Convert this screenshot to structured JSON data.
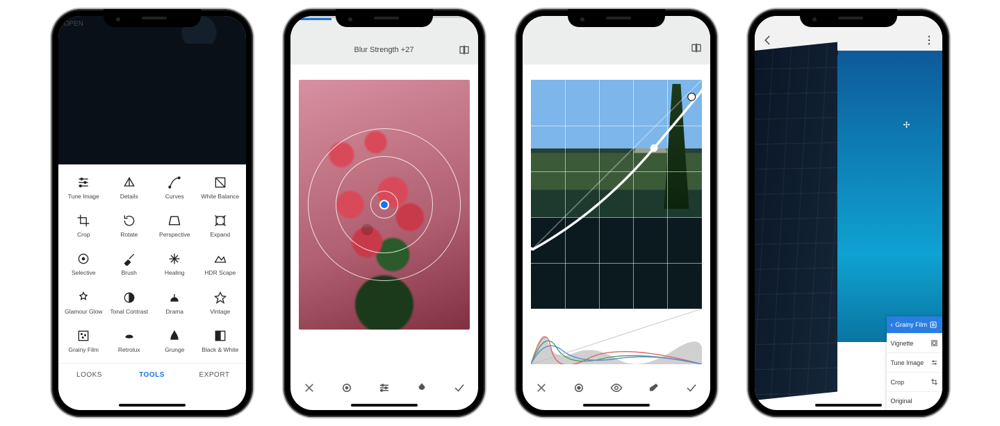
{
  "screen1": {
    "open_label": "OPEN",
    "tools": [
      {
        "label": "Tune Image",
        "icon": "sliders"
      },
      {
        "label": "Details",
        "icon": "details"
      },
      {
        "label": "Curves",
        "icon": "curves"
      },
      {
        "label": "White Balance",
        "icon": "wb"
      },
      {
        "label": "Crop",
        "icon": "crop"
      },
      {
        "label": "Rotate",
        "icon": "rotate"
      },
      {
        "label": "Perspective",
        "icon": "perspective"
      },
      {
        "label": "Expand",
        "icon": "expand"
      },
      {
        "label": "Selective",
        "icon": "selective"
      },
      {
        "label": "Brush",
        "icon": "brush"
      },
      {
        "label": "Healing",
        "icon": "healing"
      },
      {
        "label": "HDR Scape",
        "icon": "hdr"
      },
      {
        "label": "Glamour Glow",
        "icon": "glow"
      },
      {
        "label": "Tonal Contrast",
        "icon": "tonal"
      },
      {
        "label": "Drama",
        "icon": "drama"
      },
      {
        "label": "Vintage",
        "icon": "vintage"
      },
      {
        "label": "Grainy Film",
        "icon": "grainy"
      },
      {
        "label": "Retrolux",
        "icon": "retrolux"
      },
      {
        "label": "Grunge",
        "icon": "grunge"
      },
      {
        "label": "Black & White",
        "icon": "bw"
      }
    ],
    "tabs": {
      "looks": "LOOKS",
      "tools": "TOOLS",
      "export": "EXPORT"
    }
  },
  "screen2": {
    "slider_label": "Blur Strength +27",
    "progress_pct": 22
  },
  "screen3": {},
  "screen4": {
    "stack": {
      "header": "Grainy Film",
      "items": [
        "Vignette",
        "Tune Image",
        "Crop",
        "Original"
      ]
    }
  }
}
